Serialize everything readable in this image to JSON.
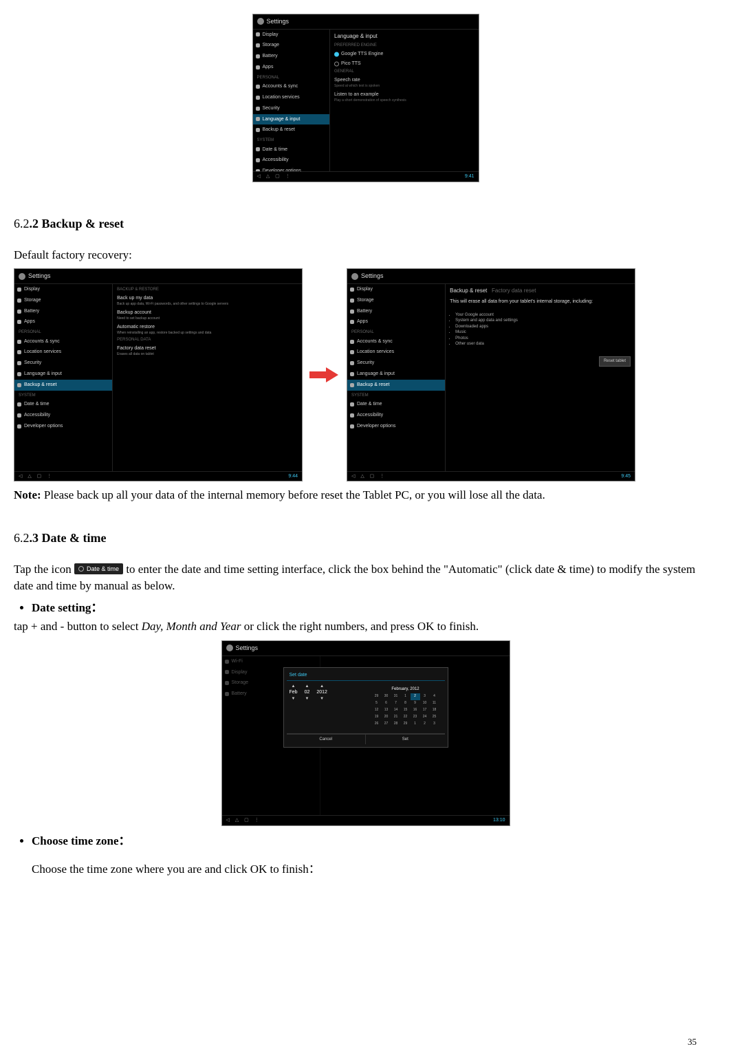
{
  "page_number": "35",
  "top_screen": {
    "title": "Settings",
    "side_heads": {
      "personal": "PERSONAL",
      "system": "SYSTEM"
    },
    "side": [
      "Display",
      "Storage",
      "Battery",
      "Apps"
    ],
    "personal": [
      "Accounts & sync",
      "Location services",
      "Security",
      "Language & input",
      "Backup & reset"
    ],
    "system": [
      "Date & time",
      "Accessibility",
      "Developer options"
    ],
    "selected": "Language & input",
    "main_title": "Language & input",
    "pref_engine": "PREFERRED ENGINE",
    "engines": [
      {
        "label": "Google TTS Engine",
        "sel": true
      },
      {
        "label": "Pico TTS",
        "sel": false
      }
    ],
    "general": "GENERAL",
    "speech_rate": "Speech rate",
    "speech_rate_desc": "Speed at which text is spoken",
    "listen": "Listen to an example",
    "listen_desc": "Play a short demonstration of speech synthesis",
    "nav_time": "9:41"
  },
  "section_622": {
    "heading_num": "6.2",
    "heading_rest": ".2 Backup & reset",
    "intro": "Default factory recovery:"
  },
  "mid_left": {
    "title": "Settings",
    "side": [
      "Display",
      "Storage",
      "Battery",
      "Apps"
    ],
    "personal_head": "PERSONAL",
    "personal": [
      "Accounts & sync",
      "Location services",
      "Security",
      "Language & input",
      "Backup & reset"
    ],
    "system_head": "SYSTEM",
    "system": [
      "Date & time",
      "Accessibility",
      "Developer options"
    ],
    "selected": "Backup & reset",
    "main_sub1": "BACKUP & RESTORE",
    "backup_data": "Back up my data",
    "backup_data_desc": "Back up app data, Wi-Fi passwords, and other settings to Google servers",
    "backup_acct": "Backup account",
    "backup_acct_desc": "Need to set backup account",
    "auto_restore": "Automatic restore",
    "auto_restore_desc": "When reinstalling an app, restore backed up settings and data",
    "main_sub2": "PERSONAL DATA",
    "factory": "Factory data reset",
    "factory_desc": "Erases all data on tablet",
    "nav_time": "9:44"
  },
  "mid_right": {
    "title": "Settings",
    "side": [
      "Display",
      "Storage",
      "Battery",
      "Apps"
    ],
    "personal_head": "PERSONAL",
    "personal": [
      "Accounts & sync",
      "Location services",
      "Security",
      "Language & input",
      "Backup & reset"
    ],
    "system_head": "SYSTEM",
    "system": [
      "Date & time",
      "Accessibility",
      "Developer options"
    ],
    "selected": "Backup & reset",
    "crumb": "Backup & reset",
    "fdr": "Factory data reset",
    "warn": "This will erase all data from your tablet's internal storage, including:",
    "bullets": [
      "Your Google account",
      "System and app data and settings",
      "Downloaded apps",
      "Music",
      "Photos",
      "Other user data"
    ],
    "reset_btn": "Reset tablet",
    "nav_time": "9:45"
  },
  "note": {
    "bold": "Note: ",
    "text": "Please back up all your data of the internal memory before reset the Tablet PC, or you will lose all the data."
  },
  "section_623": {
    "heading_num": "6.2",
    "heading_rest": ".3 Date & time",
    "tap_a": "Tap the icon ",
    "badge": "Date & time",
    "tap_b": " to enter the date and time setting interface, click the box behind the \"Automatic\" (click date & time) to modify the system date and time by manual as below.",
    "date_setting": "Date setting：",
    "date_setting_text_a": "tap + and - button to select ",
    "date_setting_italic": "Day, Month and Year",
    "date_setting_text_b": " or click the right numbers, and press OK to finish.",
    "choose_tz": "Choose time zone：",
    "choose_tz_text": "Choose the time zone where you are and click OK to finish："
  },
  "date_screen": {
    "title": "Settings",
    "dialog_title": "Set date",
    "spins": {
      "mon": "Feb",
      "day": "02",
      "year": "2012"
    },
    "cal_head": "February, 2012",
    "cancel": "Cancel",
    "set": "Set",
    "nav_time": "13:10"
  }
}
